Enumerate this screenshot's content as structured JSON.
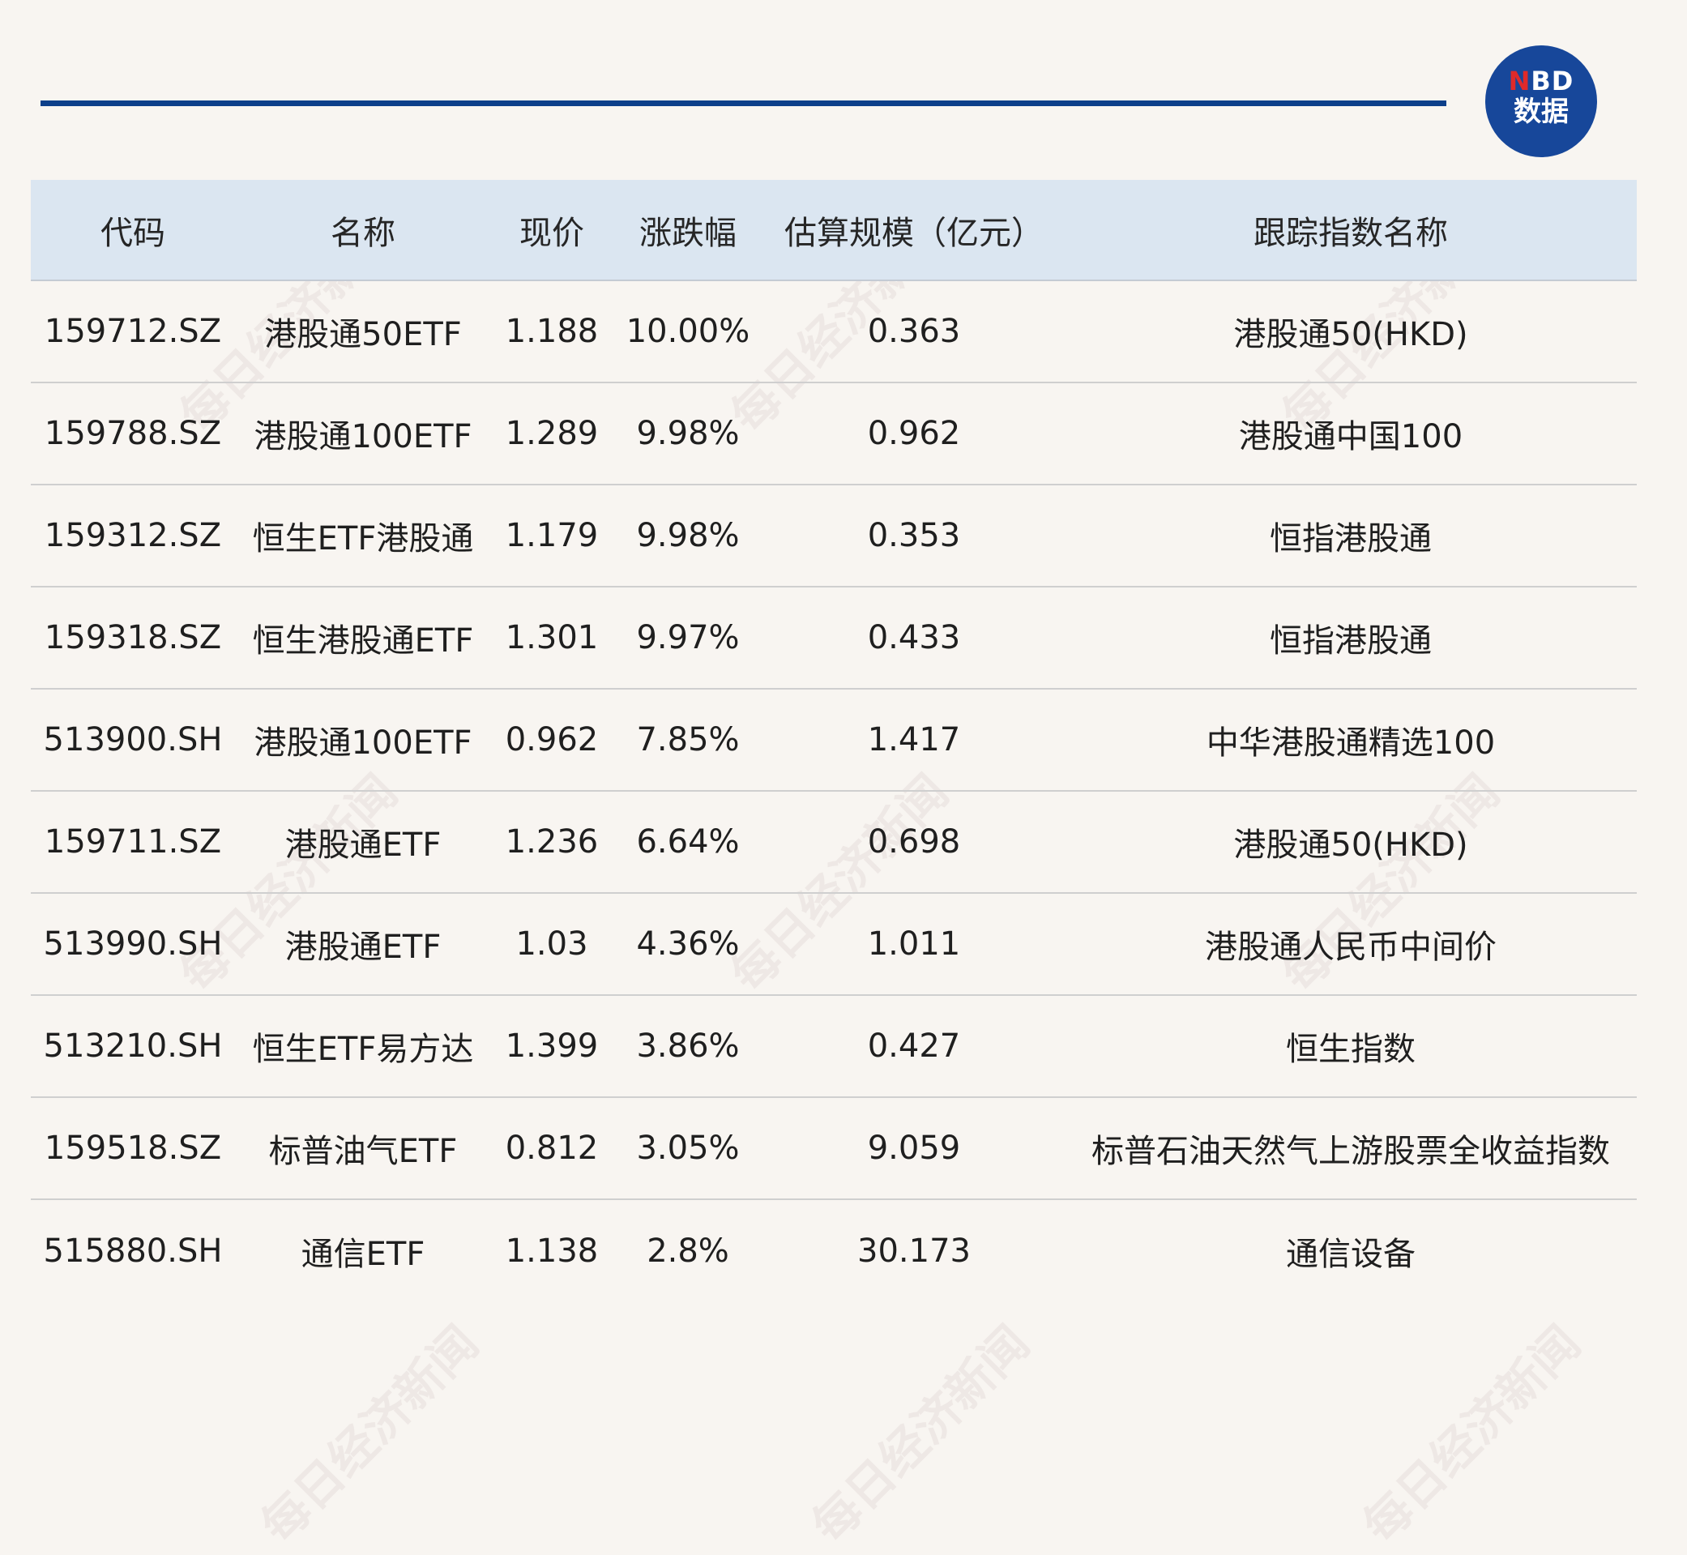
{
  "logo": {
    "line1_n": "N",
    "line1_rest": "BD",
    "line2": "数据"
  },
  "watermark": {
    "text": "每日经济新闻"
  },
  "table": {
    "headers": {
      "code": "代码",
      "name": "名称",
      "price": "现价",
      "change": "涨跌幅",
      "size": "估算规模（亿元）",
      "index": "跟踪指数名称"
    },
    "rows": [
      {
        "code": "159712.SZ",
        "name": "港股通50ETF",
        "price": "1.188",
        "change": "10.00%",
        "size": "0.363",
        "index": "港股通50(HKD)"
      },
      {
        "code": "159788.SZ",
        "name": "港股通100ETF",
        "price": "1.289",
        "change": "9.98%",
        "size": "0.962",
        "index": "港股通中国100"
      },
      {
        "code": "159312.SZ",
        "name": "恒生ETF港股通",
        "price": "1.179",
        "change": "9.98%",
        "size": "0.353",
        "index": "恒指港股通"
      },
      {
        "code": "159318.SZ",
        "name": "恒生港股通ETF",
        "price": "1.301",
        "change": "9.97%",
        "size": "0.433",
        "index": "恒指港股通"
      },
      {
        "code": "513900.SH",
        "name": "港股通100ETF",
        "price": "0.962",
        "change": "7.85%",
        "size": "1.417",
        "index": "中华港股通精选100"
      },
      {
        "code": "159711.SZ",
        "name": "港股通ETF",
        "price": "1.236",
        "change": "6.64%",
        "size": "0.698",
        "index": "港股通50(HKD)"
      },
      {
        "code": "513990.SH",
        "name": "港股通ETF",
        "price": "1.03",
        "change": "4.36%",
        "size": "1.011",
        "index": "港股通人民币中间价"
      },
      {
        "code": "513210.SH",
        "name": "恒生ETF易方达",
        "price": "1.399",
        "change": "3.86%",
        "size": "0.427",
        "index": "恒生指数"
      },
      {
        "code": "159518.SZ",
        "name": "标普油气ETF",
        "price": "0.812",
        "change": "3.05%",
        "size": "9.059",
        "index": "标普石油天然气上游股票全收益指数"
      },
      {
        "code": "515880.SH",
        "name": "通信ETF",
        "price": "1.138",
        "change": "2.8%",
        "size": "30.173",
        "index": "通信设备"
      }
    ]
  }
}
